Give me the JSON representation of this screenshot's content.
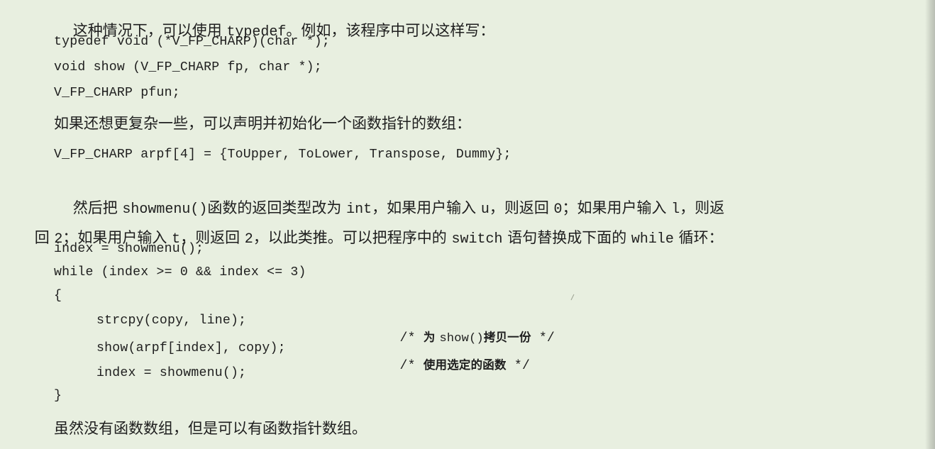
{
  "p1": {
    "t1": "这种情况下，可以使用 ",
    "t2": "typedef",
    "t3": "。例如，该程序中可以这样写："
  },
  "code1": [
    "typedef void (*V_FP_CHARP)(char *);",
    "void show (V_FP_CHARP fp, char *);",
    "V_FP_CHARP pfun;"
  ],
  "p2": "如果还想更复杂一些，可以声明并初始化一个函数指针的数组：",
  "code2": "V_FP_CHARP arpf[4] = {ToUpper, ToLower, Transpose, Dummy};",
  "p3": {
    "a1": "然后把 ",
    "a2": "showmenu()",
    "a3": "函数的返回类型改为 ",
    "a4": "int",
    "a5": "，如果用户输入 ",
    "a6": "u",
    "a7": "，则返回 ",
    "a8": "0",
    "a9": "；如果用户输入 ",
    "a10": "l",
    "a11": "，则返",
    "b1": "回 ",
    "b2": "2",
    "b3": "；如果用户输入 ",
    "b4": "t",
    "b5": "，则返回 ",
    "b6": "2",
    "b7": "，以此类推。可以把程序中的 ",
    "b8": "switch",
    "b9": " 语句替换成下面的 ",
    "b10": "while",
    "b11": " 循环："
  },
  "code3": {
    "l1": "index = showmenu();",
    "l2": "while (index >= 0 && index <= 3)",
    "l3": "{",
    "l4_code": "strcpy(copy, line);",
    "l4_c1": "/* ",
    "l4_c2": "为 ",
    "l4_c3": "show()",
    "l4_c4": "拷贝一份",
    "l4_c5": " */",
    "l5_code": "show(arpf[index], copy);",
    "l5_c1": "/* ",
    "l5_c2": "使用选定的函数",
    "l5_c3": " */",
    "l6": "index = showmenu();",
    "l7": "}"
  },
  "p4": "虽然没有函数数组，但是可以有函数指针数组。"
}
